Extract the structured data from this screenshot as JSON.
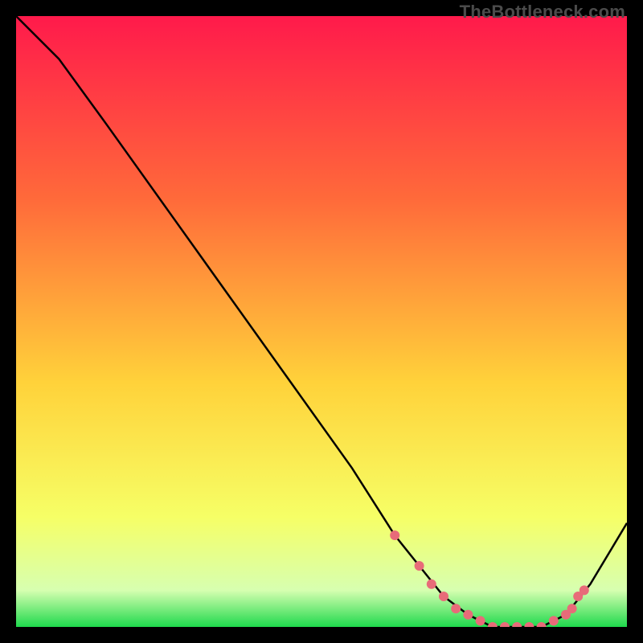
{
  "watermark": "TheBottleneck.com",
  "colors": {
    "gradient_top": "#ff1a4b",
    "gradient_mid1": "#ff6a3a",
    "gradient_mid2": "#ffd23a",
    "gradient_mid3": "#f6ff66",
    "gradient_bottom": "#1fd94d",
    "curve": "#000000",
    "marker": "#e86b79"
  },
  "chart_data": {
    "type": "line",
    "title": "",
    "xlabel": "",
    "ylabel": "",
    "xlim": [
      0,
      100
    ],
    "ylim": [
      0,
      100
    ],
    "series": [
      {
        "name": "bottleneck-curve",
        "x": [
          0,
          7,
          15,
          25,
          35,
          45,
          55,
          62,
          66,
          70,
          74,
          78,
          82,
          86,
          90,
          94,
          100
        ],
        "y": [
          100,
          93,
          82,
          68,
          54,
          40,
          26,
          15,
          10,
          5,
          2,
          0,
          0,
          0,
          2,
          7,
          17
        ]
      }
    ],
    "markers": {
      "name": "highlight-points",
      "x": [
        62,
        66,
        68,
        70,
        72,
        74,
        76,
        78,
        80,
        82,
        84,
        86,
        88,
        90,
        91,
        92,
        93
      ],
      "y": [
        15,
        10,
        7,
        5,
        3,
        2,
        1,
        0,
        0,
        0,
        0,
        0,
        1,
        2,
        3,
        5,
        6
      ]
    }
  }
}
